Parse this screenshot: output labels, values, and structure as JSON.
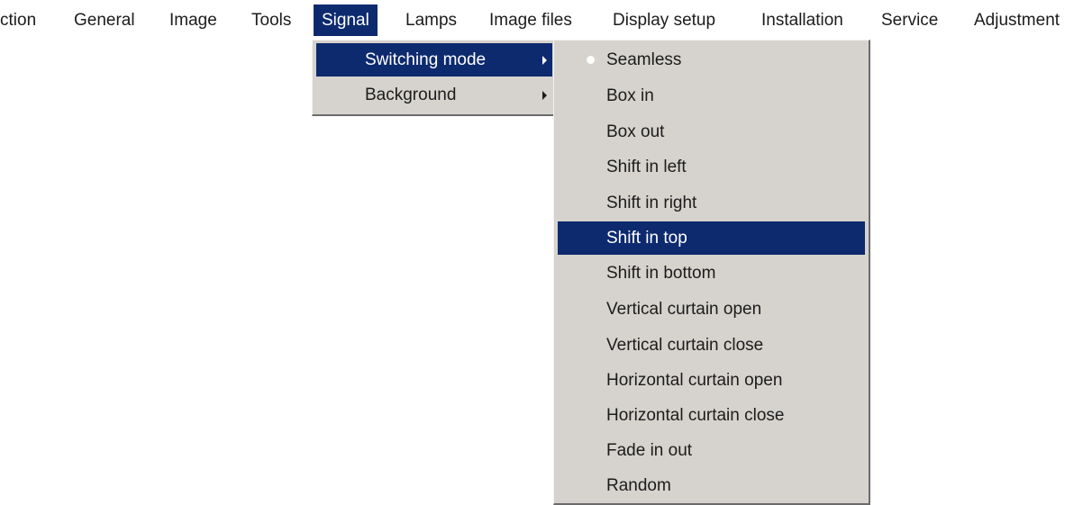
{
  "menubar": {
    "items": [
      {
        "label": "ction"
      },
      {
        "label": "General"
      },
      {
        "label": "Image"
      },
      {
        "label": "Tools"
      },
      {
        "label": "Signal"
      },
      {
        "label": "Lamps"
      },
      {
        "label": "Image files"
      },
      {
        "label": "Display setup"
      },
      {
        "label": "Installation"
      },
      {
        "label": "Service"
      },
      {
        "label": "Adjustment"
      }
    ],
    "active_item": "Signal"
  },
  "signal_menu": {
    "items": [
      {
        "label": "Switching mode"
      },
      {
        "label": "Background"
      }
    ],
    "selected_item": "Switching mode"
  },
  "switching_mode_menu": {
    "items": [
      {
        "label": "Seamless"
      },
      {
        "label": "Box in"
      },
      {
        "label": "Box out"
      },
      {
        "label": "Shift in left"
      },
      {
        "label": "Shift in right"
      },
      {
        "label": "Shift in top"
      },
      {
        "label": "Shift in bottom"
      },
      {
        "label": "Vertical curtain open"
      },
      {
        "label": "Vertical curtain close"
      },
      {
        "label": "Horizontal curtain open"
      },
      {
        "label": "Horizontal curtain close"
      },
      {
        "label": "Fade in out"
      },
      {
        "label": "Random"
      }
    ],
    "checked_item": "Seamless",
    "highlighted_item": "Shift in top"
  },
  "colors": {
    "highlight": "#0d2a6f",
    "menu_background": "#d6d3ce",
    "text": "#1c1c1c"
  },
  "icons": {
    "submenu_arrow": "triangle-right",
    "checked_marker": "bullet"
  }
}
